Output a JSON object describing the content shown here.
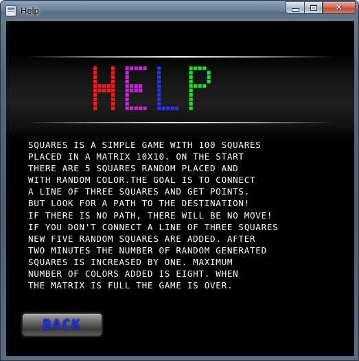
{
  "window": {
    "title": "Help",
    "controls": {
      "minimize": "minimize",
      "maximize": "maximize",
      "close": "✕"
    }
  },
  "banner": {
    "letters": [
      {
        "char": "H",
        "color": "#ff1a1a"
      },
      {
        "char": "E",
        "color": "#cc22dd"
      },
      {
        "char": "L",
        "color": "#2233ff"
      },
      {
        "char": "P",
        "color": "#22dd22"
      }
    ]
  },
  "help_text": "Squares is a simple game with 100 squares\nplaced in a matrix 10x10. On the start\nthere are 5 squares random placed and\nwith random color.The goal is to connect\na line of three squares and get points.\nBut look for a path to the destination!\nIf there is no path, there will be no move!\nIf you don't connect a line of three squares\nnew five random squares are added. After\ntwo minutes the number of random generated\nsquares is increased by one. Maximum\nnumber of colors added is eight. When\nthe matrix is full the game is over.",
  "back_button": {
    "label": "Back"
  }
}
